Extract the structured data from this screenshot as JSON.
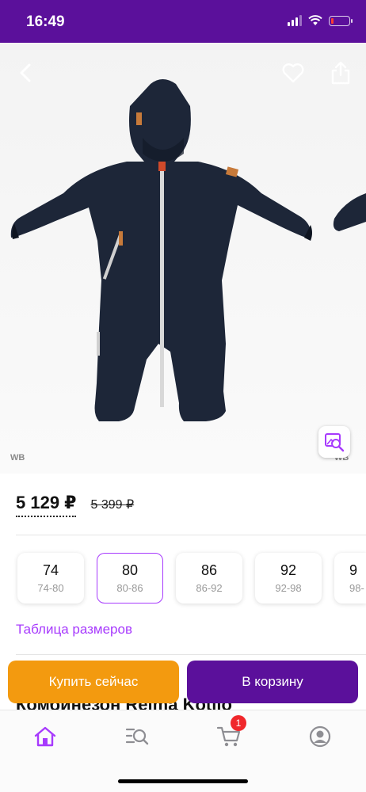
{
  "status_bar": {
    "time": "16:49"
  },
  "gallery": {
    "watermark_left": "WB",
    "watermark_right": "WB"
  },
  "product": {
    "price_current": "5 129 ₽",
    "price_old": "5 399 ₽",
    "title": "Комбинезон Reima Kotilo"
  },
  "sizes": [
    {
      "size": "74",
      "range": "74-80",
      "selected": false
    },
    {
      "size": "80",
      "range": "80-86",
      "selected": true
    },
    {
      "size": "86",
      "range": "86-92",
      "selected": false
    },
    {
      "size": "92",
      "range": "92-98",
      "selected": false
    },
    {
      "size": "9",
      "range": "98-",
      "selected": false
    }
  ],
  "size_table_link": "Таблица размеров",
  "actions": {
    "buy_now": "Купить сейчас",
    "add_to_cart": "В корзину"
  },
  "tab_bar": {
    "cart_badge": "1",
    "icons": [
      "home-icon",
      "catalog-search-icon",
      "cart-icon",
      "profile-icon"
    ]
  },
  "colors": {
    "brand": "#5b109b",
    "accent": "#a73afd",
    "buy_now": "#f39a0f",
    "badge": "#f0272b"
  }
}
